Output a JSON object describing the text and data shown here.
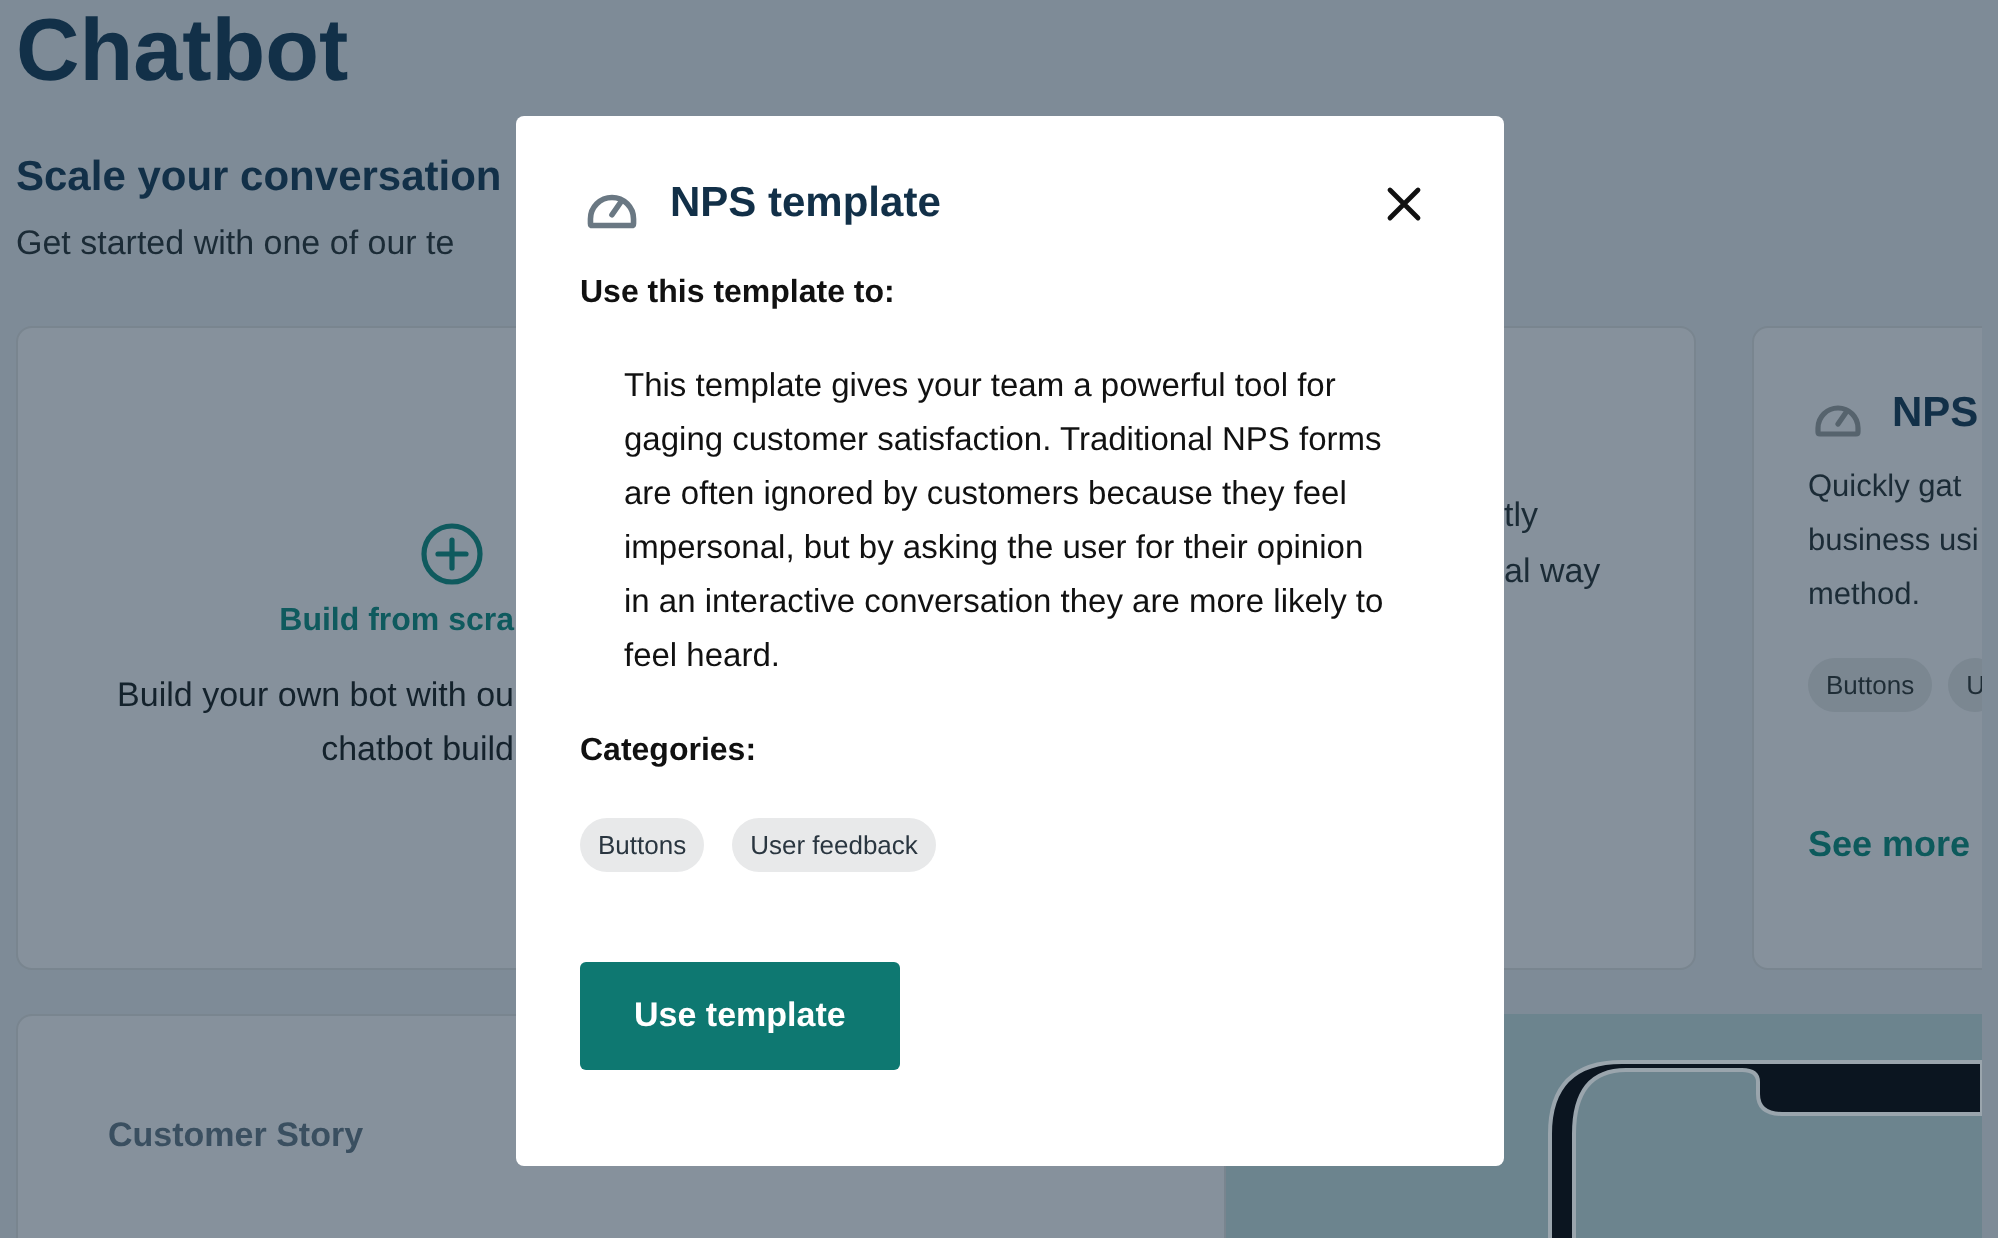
{
  "page": {
    "title": "Chatbot",
    "subtitle": "Scale your conversation",
    "intro": "Get started with one of our te"
  },
  "template_cards": [
    {
      "kind": "scratch",
      "title": "Build from scra",
      "lines": [
        "Build your own bot with ou",
        "chatbot build"
      ]
    },
    {
      "kind": "fragment",
      "lines": [
        "tly",
        "al way"
      ]
    },
    {
      "kind": "template",
      "title": "NPS",
      "lines": [
        "Quickly gat",
        "business usi",
        "method."
      ],
      "tags": [
        "Buttons",
        "U"
      ],
      "link": "See more"
    }
  ],
  "story_card": {
    "label": "Customer Story"
  },
  "modal": {
    "title": "NPS template",
    "section_label": "Use this template to:",
    "description": "This template gives your team a powerful tool for gaging customer satisfaction. Traditional NPS forms are often ignored by customers because they feel impersonal, but by asking the user for their opinion in an interactive conversation they are more likely to feel heard.",
    "categories_label": "Categories:",
    "categories": [
      "Buttons",
      "User feedback"
    ],
    "primary_button": "Use template"
  }
}
